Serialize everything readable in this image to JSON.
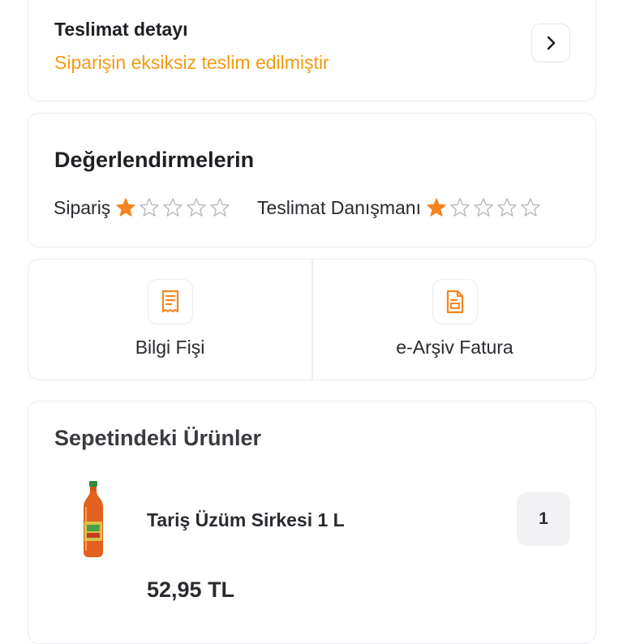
{
  "delivery": {
    "title": "Teslimat detayı",
    "status": "Siparişin eksiksiz teslim edilmiştir",
    "status_color": "#f39a12"
  },
  "ratings": {
    "title": "Değerlendirmelerin",
    "order": {
      "label": "Sipariş",
      "stars": 1,
      "max": 5
    },
    "courier": {
      "label": "Teslimat Danışmanı",
      "stars": 1,
      "max": 5
    },
    "star_color": "#f5841f"
  },
  "documents": [
    {
      "label": "Bilgi Fişi",
      "icon": "receipt-icon"
    },
    {
      "label": "e-Arşiv Fatura",
      "icon": "invoice-document-icon"
    }
  ],
  "basket": {
    "title": "Sepetindeki Ürünler",
    "items": [
      {
        "name": "Tariş Üzüm Sirkesi 1 L",
        "quantity": "1",
        "price": "52,95 TL",
        "image_icon": "vinegar-bottle-image"
      }
    ]
  }
}
